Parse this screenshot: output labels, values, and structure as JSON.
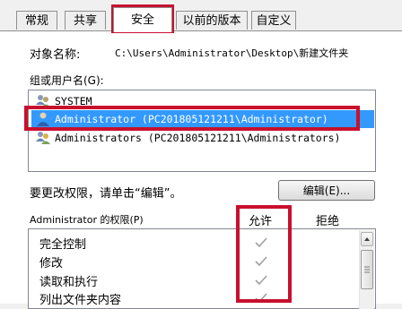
{
  "tabs": [
    {
      "label": "常规"
    },
    {
      "label": "共享"
    },
    {
      "label": "安全"
    },
    {
      "label": "以前的版本"
    },
    {
      "label": "自定义"
    }
  ],
  "object": {
    "label": "对象名称:",
    "value": "C:\\Users\\Administrator\\Desktop\\新建文件夹"
  },
  "groups": {
    "label": "组或用户名(G):",
    "items": [
      {
        "name": "SYSTEM",
        "icon": "users-group-icon"
      },
      {
        "name": "Administrator (PC201805121211\\Administrator)",
        "icon": "user-icon"
      },
      {
        "name": "Administrators (PC201805121211\\Administrators)",
        "icon": "users-group-icon"
      }
    ]
  },
  "change_hint": "要更改权限，请单击“编辑”。",
  "edit_button": "编辑(E)...",
  "permissions": {
    "label": "Administrator 的权限(P)",
    "allow_header": "允许",
    "deny_header": "拒绝",
    "items": [
      {
        "name": "完全控制",
        "allow": true
      },
      {
        "name": "修改",
        "allow": true
      },
      {
        "name": "读取和执行",
        "allow": true
      },
      {
        "name": "列出文件夹内容",
        "allow": true
      }
    ]
  },
  "colors": {
    "highlight": "#c8102e",
    "selection": "#3399ff",
    "checkmark": "#a0a0a0"
  }
}
